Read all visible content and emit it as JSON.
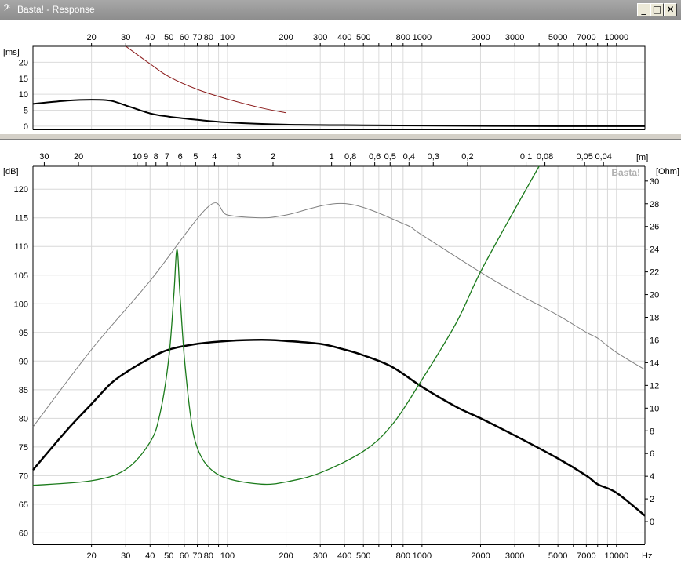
{
  "window": {
    "title": "Basta! - Response",
    "app_icon": "bass-clef-icon",
    "buttons": {
      "minimize": "_",
      "maximize": "□",
      "close": "✕"
    }
  },
  "chart_data": [
    {
      "type": "line",
      "name": "group-delay",
      "xscale": "log",
      "xlim": [
        10,
        14000
      ],
      "ylim": [
        -1,
        25
      ],
      "ylabel": "[ms]",
      "yticks": [
        0,
        5,
        10,
        15,
        20
      ],
      "xticklabels": [
        "20",
        "30",
        "40",
        "50",
        "60",
        "70",
        "80",
        "100",
        "200",
        "300",
        "400",
        "500",
        "800",
        "1000",
        "2000",
        "3000",
        "5000",
        "7000",
        "10000"
      ],
      "colors": {
        "group_delay": "#000000",
        "reference": "#8b1a1a"
      },
      "series": [
        {
          "key": "group_delay",
          "x": [
            10,
            15,
            20,
            25,
            30,
            40,
            50,
            70,
            100,
            200,
            500,
            1000,
            5000,
            14000
          ],
          "y": [
            7.0,
            8.0,
            8.3,
            8.0,
            6.5,
            4.0,
            3.0,
            2.0,
            1.2,
            0.5,
            0.3,
            0.2,
            0.0,
            0.0
          ]
        },
        {
          "key": "reference",
          "x": [
            30,
            40,
            50,
            70,
            100,
            150,
            200
          ],
          "y": [
            25,
            19.5,
            15.5,
            11.5,
            8.5,
            5.7,
            4.2
          ]
        }
      ]
    },
    {
      "type": "line",
      "name": "frequency-response",
      "xscale": "log",
      "xlim": [
        10,
        14000
      ],
      "ylim": [
        58,
        124
      ],
      "ylabel": "[dB]",
      "yticks": [
        60,
        65,
        70,
        75,
        80,
        85,
        90,
        95,
        100,
        105,
        110,
        115,
        120
      ],
      "y2lim": [
        -2,
        31.3
      ],
      "y2label": "[Ohm]",
      "y2ticks": [
        0,
        2,
        4,
        6,
        8,
        10,
        12,
        14,
        16,
        18,
        20,
        22,
        24,
        26,
        28,
        30
      ],
      "xlabel": "Hz",
      "xticklabels": [
        "20",
        "30",
        "40",
        "50",
        "60",
        "70",
        "80",
        "100",
        "200",
        "300",
        "400",
        "500",
        "800",
        "1000",
        "2000",
        "3000",
        "5000",
        "7000",
        "10000"
      ],
      "toplabel": "[m]",
      "topticks": [
        "30",
        "20",
        "10",
        "9",
        "8",
        "7",
        "6",
        "5",
        "4",
        "3",
        "2",
        "1",
        "0,8",
        "0,6",
        "0,5",
        "0,4",
        "0,3",
        "0,2",
        "0,1",
        "0,08",
        "0,05",
        "0,04"
      ],
      "watermark": "Basta!",
      "colors": {
        "spl": "#000000",
        "max_spl": "#808080",
        "impedance": "#1a7a1a"
      },
      "series": [
        {
          "key": "spl",
          "axis": "left",
          "x": [
            10,
            15,
            20,
            25,
            30,
            40,
            50,
            70,
            100,
            150,
            200,
            300,
            400,
            500,
            700,
            1000,
            1500,
            2000,
            3000,
            5000,
            7000,
            8000,
            10000,
            14000
          ],
          "y": [
            71,
            78,
            82.5,
            86,
            88,
            90.5,
            92,
            93,
            93.5,
            93.7,
            93.5,
            93,
            92,
            91,
            89,
            85.5,
            82,
            80,
            77,
            73,
            70,
            68.5,
            67,
            63
          ]
        },
        {
          "key": "max_spl",
          "axis": "left",
          "x": [
            10,
            20,
            40,
            80,
            100,
            150,
            200,
            400,
            800,
            1000,
            2000,
            3000,
            5000,
            7000,
            8000,
            10000,
            14000
          ],
          "y": [
            78.5,
            92,
            104,
            117,
            115.5,
            115,
            115.5,
            117.5,
            114,
            112,
            105.5,
            102,
            98,
            95,
            94,
            91.5,
            88.5
          ]
        },
        {
          "key": "impedance",
          "axis": "right",
          "x": [
            10,
            20,
            30,
            40,
            45,
            50,
            53,
            55,
            57,
            60,
            65,
            70,
            80,
            100,
            150,
            200,
            300,
            500,
            700,
            1000,
            1500,
            2000,
            3000,
            4000
          ],
          "y": [
            3.2,
            3.6,
            4.6,
            7.0,
            9.5,
            14.5,
            20,
            24,
            20,
            14.5,
            9,
            6.5,
            4.8,
            3.8,
            3.3,
            3.5,
            4.3,
            6.2,
            8.5,
            12.5,
            17.5,
            22,
            27.5,
            31.3
          ]
        }
      ]
    }
  ]
}
